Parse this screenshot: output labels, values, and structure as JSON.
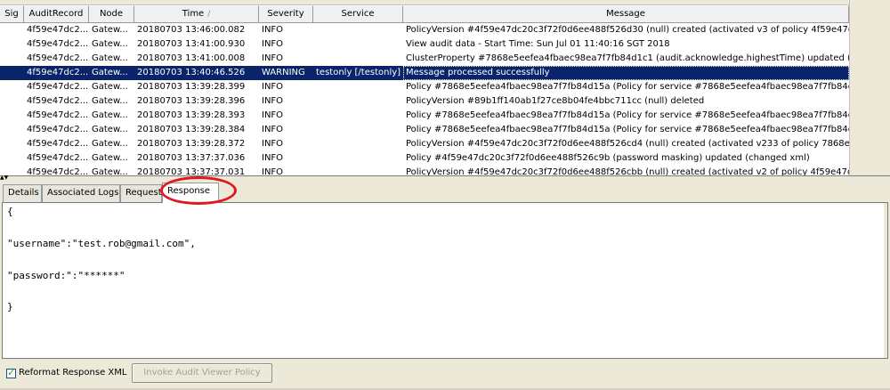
{
  "table": {
    "columns": [
      {
        "key": "sig",
        "label": "Sig"
      },
      {
        "key": "audit",
        "label": "AuditRecord"
      },
      {
        "key": "node",
        "label": "Node"
      },
      {
        "key": "time",
        "label": "Time"
      },
      {
        "key": "severity",
        "label": "Severity"
      },
      {
        "key": "service",
        "label": "Service"
      },
      {
        "key": "message",
        "label": "Message"
      }
    ],
    "sort_glyph": "/",
    "rows": [
      {
        "sig": "",
        "audit": "4f59e47dc2...",
        "node": "Gatew...",
        "time": "20180703 13:46:00.082",
        "severity": "INFO",
        "service": "",
        "message": "PolicyVersion #4f59e47dc20c3f72f0d6ee488f526d30 (null) created (activated v3 of policy 4f59e47d...",
        "selected": false
      },
      {
        "sig": "",
        "audit": "4f59e47dc2...",
        "node": "Gatew...",
        "time": "20180703 13:41:00.930",
        "severity": "INFO",
        "service": "",
        "message": "View audit data - Start Time: Sun Jul 01 11:40:16 SGT 2018",
        "selected": false
      },
      {
        "sig": "",
        "audit": "4f59e47dc2...",
        "node": "Gatew...",
        "time": "20180703 13:41:00.008",
        "severity": "INFO",
        "service": "",
        "message": "ClusterProperty #7868e5eefea4fbaec98ea7f7fb84d1c1 (audit.acknowledge.highestTime) updated (...",
        "selected": false
      },
      {
        "sig": "",
        "audit": "4f59e47dc2...",
        "node": "Gatew...",
        "time": "20180703 13:40:46.526",
        "severity": "WARNING",
        "service": "testonly [/testonly]",
        "message": "Message processed successfully",
        "selected": true
      },
      {
        "sig": "",
        "audit": "4f59e47dc2...",
        "node": "Gatew...",
        "time": "20180703 13:39:28.399",
        "severity": "INFO",
        "service": "",
        "message": "Policy #7868e5eefea4fbaec98ea7f7fb84d15a (Policy for service #7868e5eefea4fbaec98ea7f7fb84d...",
        "selected": false
      },
      {
        "sig": "",
        "audit": "4f59e47dc2...",
        "node": "Gatew...",
        "time": "20180703 13:39:28.396",
        "severity": "INFO",
        "service": "",
        "message": "PolicyVersion #89b1ff140ab1f27ce8b04fe4bbc711cc (null) deleted",
        "selected": false
      },
      {
        "sig": "",
        "audit": "4f59e47dc2...",
        "node": "Gatew...",
        "time": "20180703 13:39:28.393",
        "severity": "INFO",
        "service": "",
        "message": "Policy #7868e5eefea4fbaec98ea7f7fb84d15a (Policy for service #7868e5eefea4fbaec98ea7f7fb84d...",
        "selected": false
      },
      {
        "sig": "",
        "audit": "4f59e47dc2...",
        "node": "Gatew...",
        "time": "20180703 13:39:28.384",
        "severity": "INFO",
        "service": "",
        "message": "Policy #7868e5eefea4fbaec98ea7f7fb84d15a (Policy for service #7868e5eefea4fbaec98ea7f7fb84d...",
        "selected": false
      },
      {
        "sig": "",
        "audit": "4f59e47dc2...",
        "node": "Gatew...",
        "time": "20180703 13:39:28.372",
        "severity": "INFO",
        "service": "",
        "message": "PolicyVersion #4f59e47dc20c3f72f0d6ee488f526cd4 (null) created (activated v233 of policy 7868e5...",
        "selected": false
      },
      {
        "sig": "",
        "audit": "4f59e47dc2...",
        "node": "Gatew...",
        "time": "20180703 13:37:37.036",
        "severity": "INFO",
        "service": "",
        "message": "Policy #4f59e47dc20c3f72f0d6ee488f526c9b (password masking) updated (changed xml)",
        "selected": false
      },
      {
        "sig": "",
        "audit": "4f59e47dc2...",
        "node": "Gatew...",
        "time": "20180703 13:37:37.031",
        "severity": "INFO",
        "service": "",
        "message": "PolicyVersion #4f59e47dc20c3f72f0d6ee488f526cbb (null) created (activated v2 of policy 4f59e47dc...",
        "selected": false
      }
    ]
  },
  "tabs": {
    "details": "Details",
    "associated_logs": "Associated Logs",
    "request": "Request",
    "response": "Response",
    "active": "response"
  },
  "response_body": {
    "lines": [
      "{",
      "\"username\":\"test.rob@gmail.com\",",
      "\"password:\":\"******\"",
      "}"
    ]
  },
  "bottom_bar": {
    "reformat_label": "Reformat Response XML",
    "reformat_checked": true,
    "invoke_button_label": "Invoke Audit Viewer Policy",
    "invoke_button_enabled": false
  },
  "colors": {
    "selection_bg": "#0a246a",
    "highlight_circle": "#e0181f",
    "window_bg": "#ece9d8"
  }
}
